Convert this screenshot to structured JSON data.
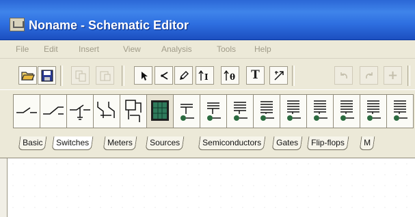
{
  "window": {
    "title": "Noname - Schematic Editor"
  },
  "menu": {
    "items": [
      "File",
      "Edit",
      "Insert",
      "View",
      "Analysis",
      "Tools",
      "Help"
    ]
  },
  "toolbar": {
    "buttons": [
      {
        "name": "open-icon",
        "glyph": "■",
        "enabled": true
      },
      {
        "name": "save-icon",
        "glyph": "▣",
        "enabled": true
      },
      {
        "name": "copy-icon",
        "glyph": "❐",
        "enabled": false
      },
      {
        "name": "paste-icon",
        "glyph": "❑",
        "enabled": false
      },
      {
        "name": "select-arrow-icon",
        "glyph": "↖",
        "enabled": true
      },
      {
        "name": "wire-icon",
        "glyph": "↲",
        "enabled": true
      },
      {
        "name": "pencil-icon",
        "glyph": "✎",
        "enabled": true
      },
      {
        "name": "current-probe-icon",
        "glyph": "↑I",
        "enabled": true
      },
      {
        "name": "voltage-probe-icon",
        "glyph": "↑θ",
        "enabled": true
      },
      {
        "name": "text-tool-icon",
        "glyph": "T",
        "enabled": true
      },
      {
        "name": "analysis-marker-icon",
        "glyph": "↗",
        "enabled": true
      },
      {
        "name": "undo-icon",
        "glyph": "↶",
        "enabled": false
      },
      {
        "name": "redo-icon",
        "glyph": "↷",
        "enabled": false
      },
      {
        "name": "zoom-in-icon",
        "glyph": "+",
        "enabled": false
      }
    ]
  },
  "palette": {
    "components": [
      "switch-open-icon",
      "switch-spdt-icon",
      "switch-push-icon",
      "switch-dpdt-icon",
      "relay-icon",
      "keypad-icon",
      "switch-led-icon",
      "switch-led-icon",
      "switch-led-icon",
      "switch-led-icon",
      "switch-led-icon"
    ]
  },
  "tabs": [
    "Basic",
    "Switches",
    "Meters",
    "Sources",
    "Semiconductors",
    "Gates",
    "Flip-flops",
    "M"
  ],
  "active_tab": "Switches"
}
